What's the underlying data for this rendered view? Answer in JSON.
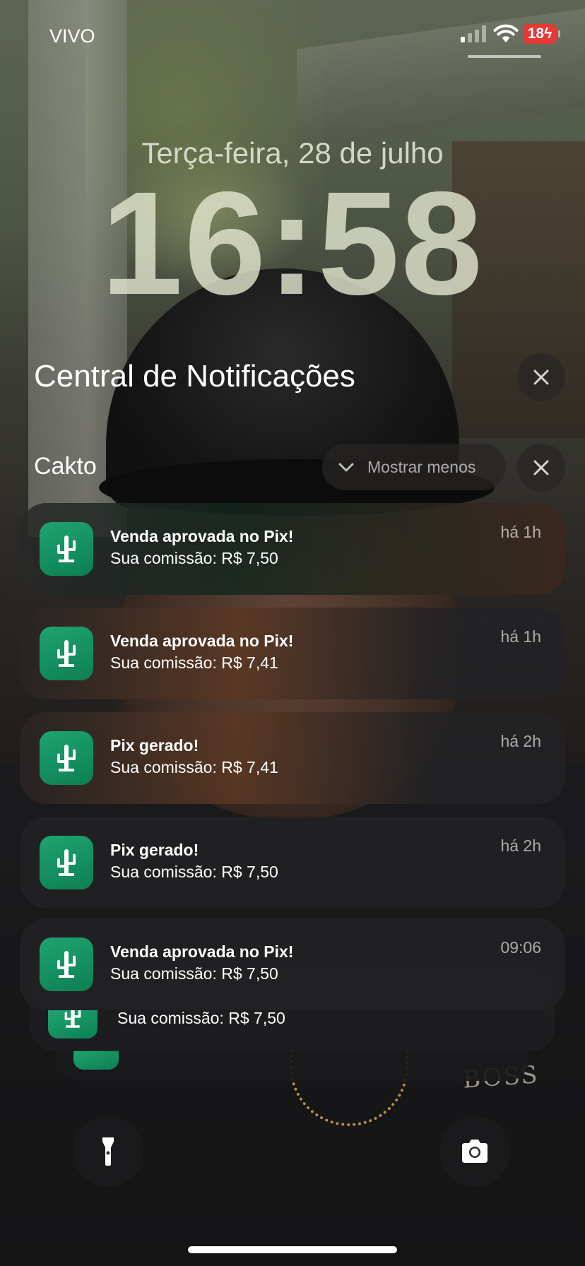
{
  "status_bar": {
    "carrier": "VIVO",
    "battery": "18",
    "signal_bars_active": 1,
    "signal_bars_total": 4,
    "battery_color": "#e53935",
    "charging": true
  },
  "lock_screen": {
    "date": "Terça-feira, 28 de julho",
    "time": "16:58"
  },
  "notification_center": {
    "title": "Central de Notificações",
    "group": {
      "app_name": "Cakto",
      "show_less_label": "Mostrar menos",
      "app_icon": "cactus-icon",
      "app_color": "#1a9a68"
    },
    "notifications": [
      {
        "title": "Venda aprovada no Pix!",
        "body": "Sua comissão: R$ 7,50",
        "time": "há 1h"
      },
      {
        "title": "Venda aprovada no Pix!",
        "body": "Sua comissão: R$ 7,41",
        "time": "há 1h"
      },
      {
        "title": "Pix gerado!",
        "body": "Sua comissão: R$ 7,41",
        "time": "há 2h"
      },
      {
        "title": "Pix gerado!",
        "body": "Sua comissão: R$ 7,50",
        "time": "há 2h"
      },
      {
        "title": "Venda aprovada no Pix!",
        "body": "Sua comissão: R$ 7,50",
        "time": "09:06"
      }
    ],
    "stacked": {
      "body": "Sua comissão: R$ 7,50"
    }
  },
  "quick_actions": {
    "left": "flashlight-icon",
    "right": "camera-icon"
  }
}
